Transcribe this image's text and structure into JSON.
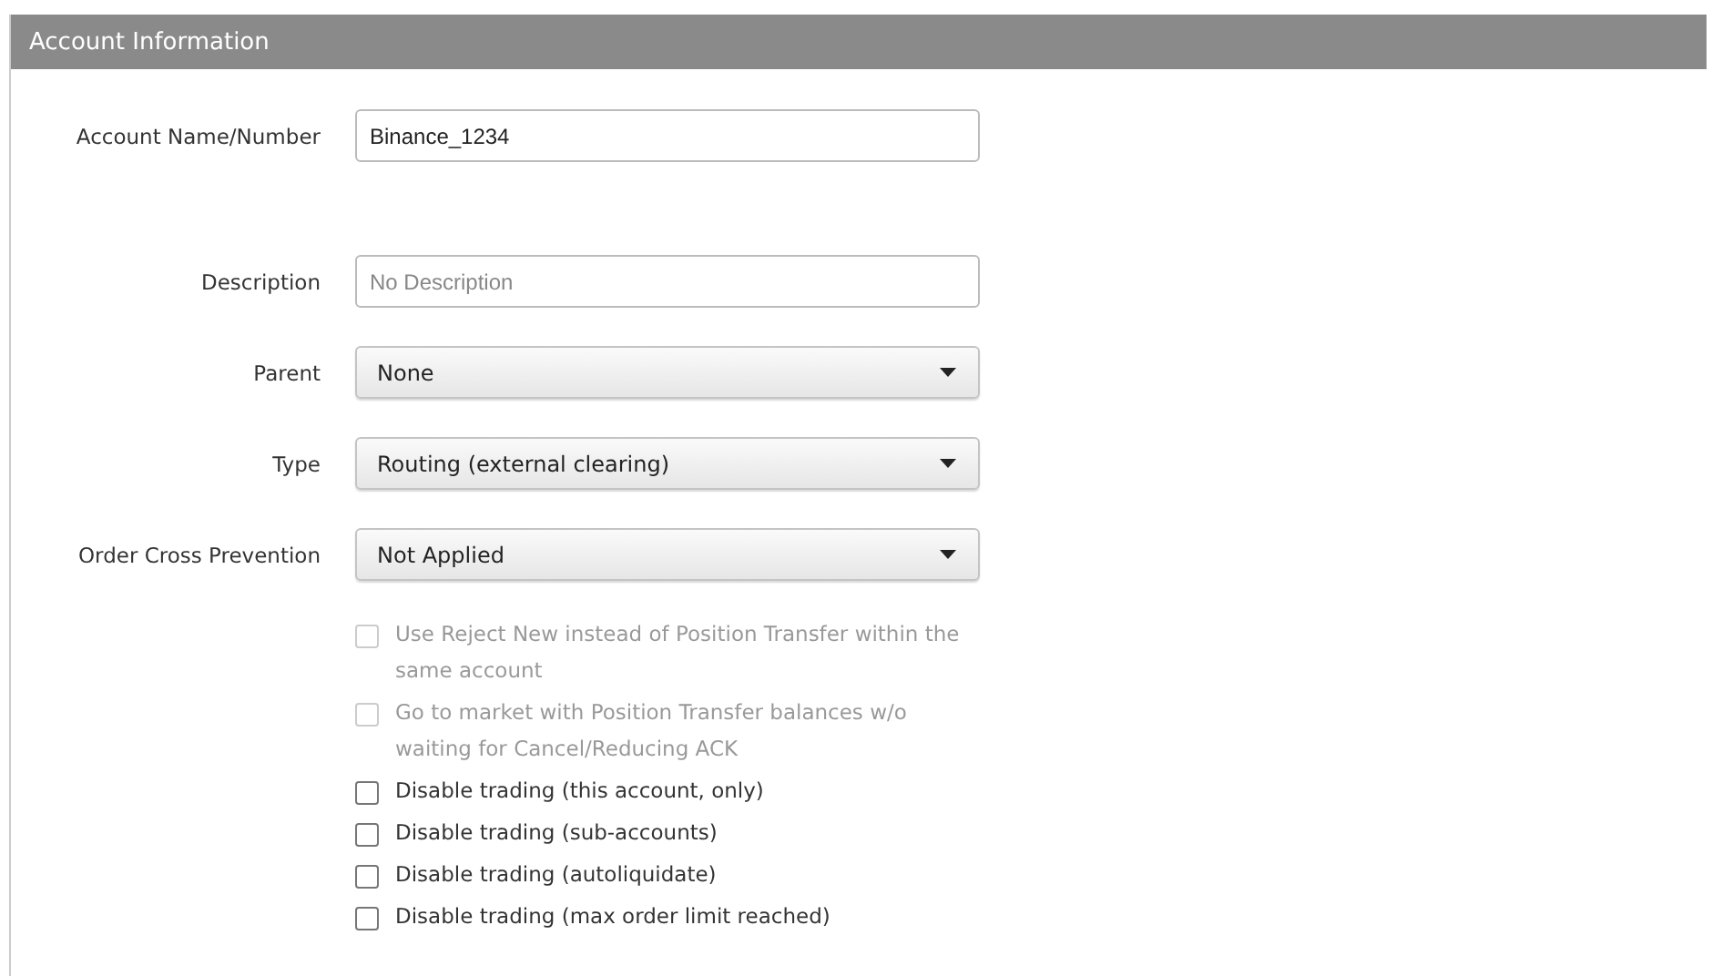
{
  "panel": {
    "title": "Account Information"
  },
  "fields": [
    {
      "kind": "text",
      "label": "Account Name/Number",
      "value": "Binance_1234"
    },
    {
      "kind": "text",
      "label": "Description",
      "placeholder": "No Description"
    },
    {
      "kind": "select",
      "label": "Parent",
      "value": "None"
    },
    {
      "kind": "select",
      "label": "Type",
      "value": "Routing (external clearing)"
    },
    {
      "kind": "select",
      "label": "Order Cross Prevention",
      "value": "Not Applied"
    }
  ],
  "checkboxes": [
    {
      "label": "Use Reject New instead of Position Transfer within the same account",
      "checked": false,
      "disabled": true
    },
    {
      "label": "Go to market with Position Transfer balances w/o waiting for Cancel/Reducing ACK",
      "checked": false,
      "disabled": true
    },
    {
      "label": "Disable trading (this account, only)",
      "checked": false,
      "disabled": false
    },
    {
      "label": "Disable trading (sub-accounts)",
      "checked": false,
      "disabled": false
    },
    {
      "label": "Disable trading (autoliquidate)",
      "checked": false,
      "disabled": false
    },
    {
      "label": "Disable trading (max order limit reached)",
      "checked": false,
      "disabled": false
    }
  ]
}
